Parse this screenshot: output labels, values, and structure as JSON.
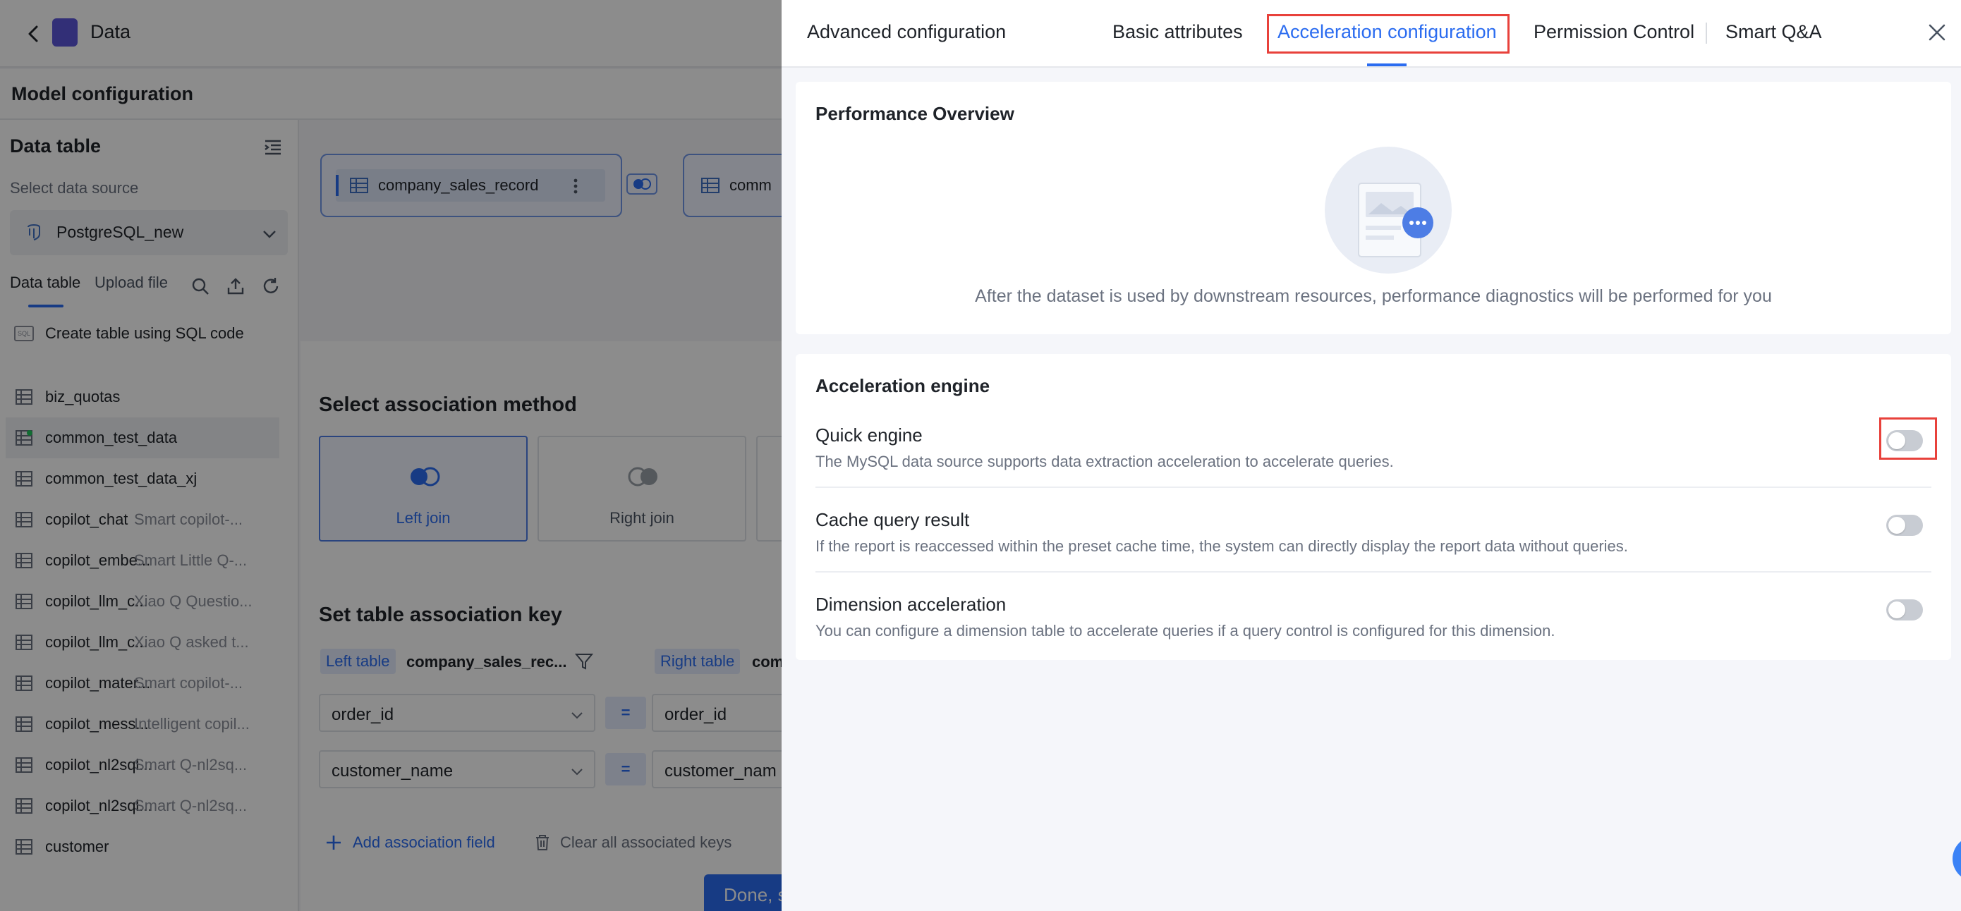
{
  "app": {
    "title": "Data"
  },
  "subbar": {
    "title": "Model configuration"
  },
  "sidebar": {
    "heading": "Data table",
    "source_label": "Select data source",
    "source_value": "PostgreSQL_new",
    "tabs": [
      "Data table",
      "Upload file"
    ],
    "sql_action": "Create table using SQL code",
    "tables": [
      {
        "name": "biz_quotas",
        "desc": ""
      },
      {
        "name": "common_test_data",
        "desc": ""
      },
      {
        "name": "common_test_data_xj",
        "desc": ""
      },
      {
        "name": "copilot_chat",
        "desc": "Smart copilot-..."
      },
      {
        "name": "copilot_embe...",
        "desc": "Smart Little Q-..."
      },
      {
        "name": "copilot_llm_c...",
        "desc": "Xiao Q Questio..."
      },
      {
        "name": "copilot_llm_c...",
        "desc": "Xiao Q asked t..."
      },
      {
        "name": "copilot_mater...",
        "desc": "Smart copilot-..."
      },
      {
        "name": "copilot_mess...",
        "desc": "Intelligent copil..."
      },
      {
        "name": "copilot_nl2sql...",
        "desc": "Smart Q-nl2sq..."
      },
      {
        "name": "copilot_nl2sql...",
        "desc": "Smart Q-nl2sq..."
      },
      {
        "name": "customer",
        "desc": ""
      }
    ]
  },
  "canvas": {
    "nodes": [
      "company_sales_record",
      "comm"
    ]
  },
  "association": {
    "method_title": "Select association method",
    "methods": [
      "Left join",
      "Right join"
    ],
    "key_title": "Set table association key",
    "left_tag": "Left table",
    "left_table": "company_sales_rec...",
    "right_tag": "Right table",
    "right_table": "com",
    "keys": [
      {
        "left": "order_id",
        "op": "=",
        "right": "order_id"
      },
      {
        "left": "customer_name",
        "op": "=",
        "right": "customer_nam"
      }
    ],
    "add_field": "Add association field",
    "clear_keys": "Clear all associated keys",
    "done": "Done, s"
  },
  "drawer": {
    "title": "Advanced configuration",
    "tabs": [
      "Basic attributes",
      "Acceleration configuration",
      "Permission Control",
      "Smart Q&A"
    ],
    "active_tab": "Acceleration configuration",
    "performance": {
      "title": "Performance Overview",
      "message": "After the dataset is used by downstream resources, performance diagnostics will be performed for you"
    },
    "engine": {
      "title": "Acceleration engine",
      "options": [
        {
          "title": "Quick engine",
          "desc": "The MySQL data source supports data extraction acceleration to accelerate queries.",
          "enabled": false
        },
        {
          "title": "Cache query result",
          "desc": "If the report is reaccessed within the preset cache time, the system can directly display the report data without queries.",
          "enabled": false
        },
        {
          "title": "Dimension acceleration",
          "desc": "You can configure a dimension table to accelerate queries if a query control is configured for this dimension.",
          "enabled": false
        }
      ]
    }
  },
  "colors": {
    "accent": "#2b6cf0",
    "highlight": "#e8413b",
    "brand": "#5b57d9"
  }
}
